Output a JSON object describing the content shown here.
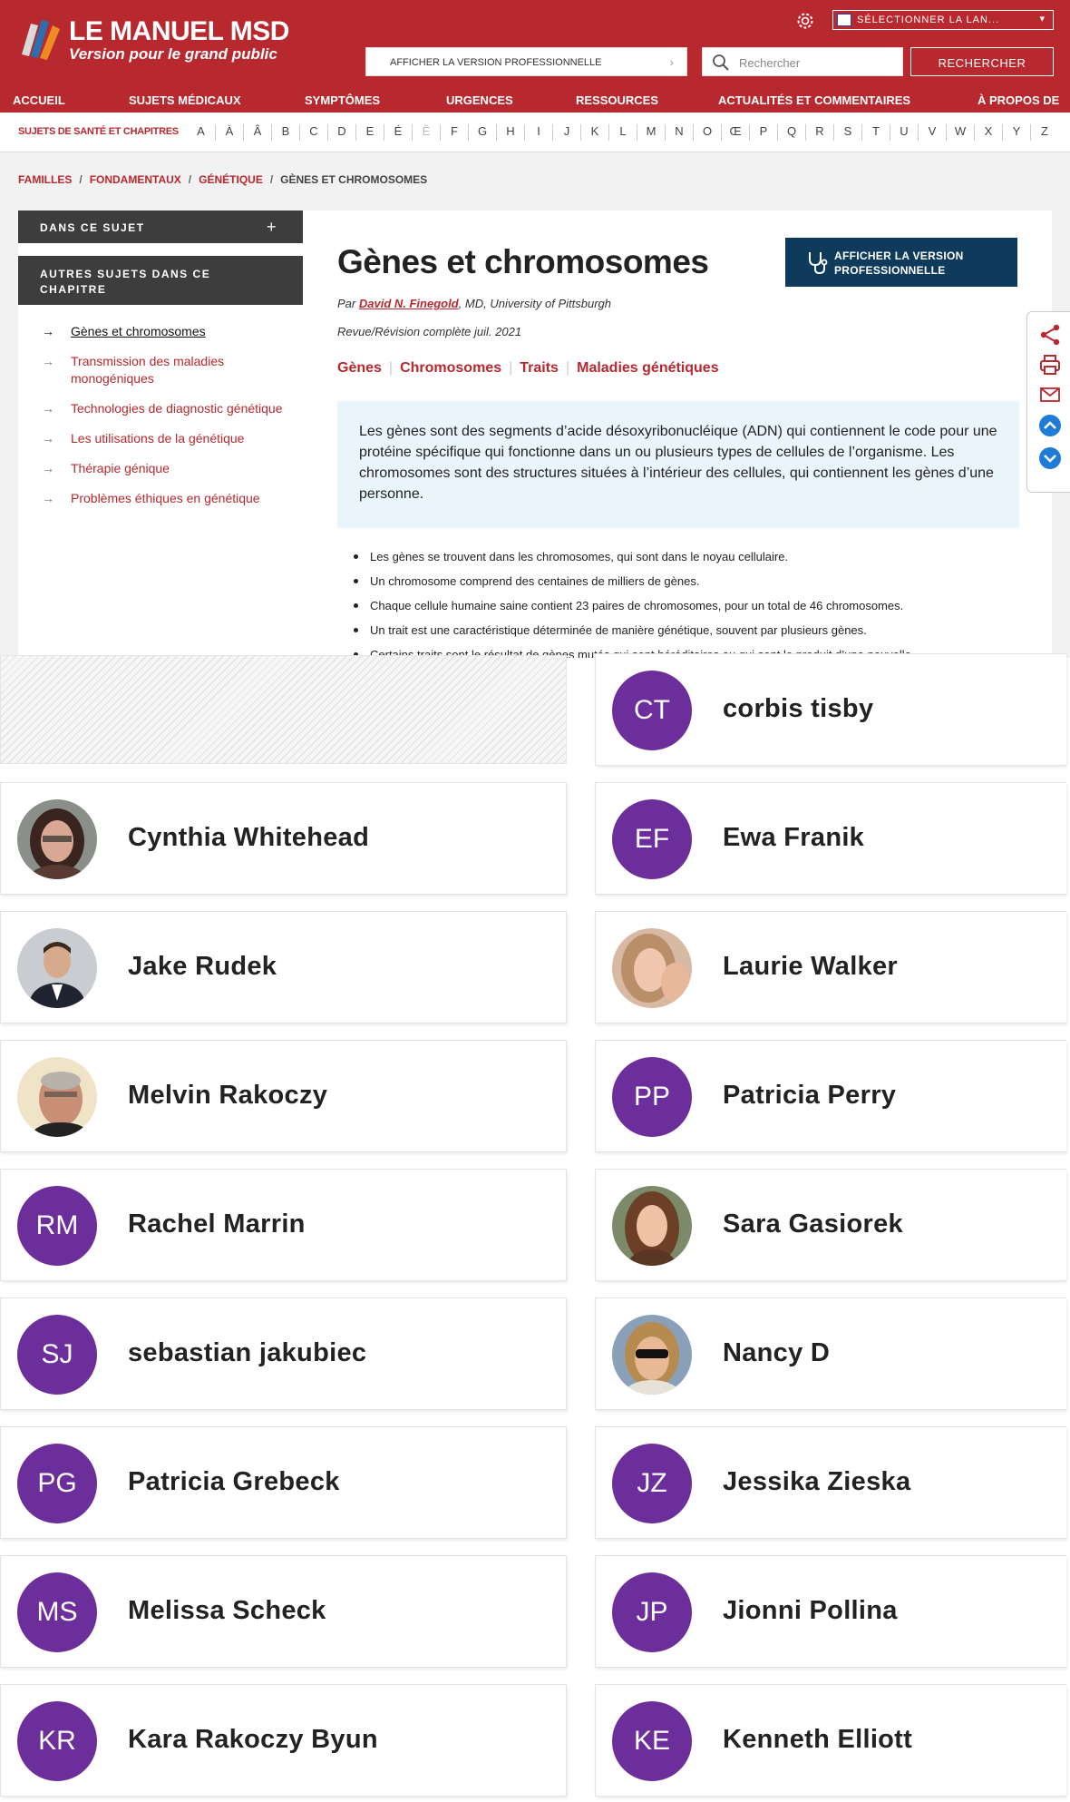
{
  "header": {
    "logo_title": "LE MANUEL MSD",
    "logo_subtitle": "Version pour le grand public",
    "language_select": "SÉLECTIONNER LA LAN...",
    "pro_version_link": "AFFICHER LA VERSION PROFESSIONNELLE",
    "search_placeholder": "Rechercher",
    "search_button": "RECHERCHER",
    "nav": [
      "ACCUEIL",
      "SUJETS MÉDICAUX",
      "SYMPTÔMES",
      "URGENCES",
      "RESSOURCES",
      "ACTUALITÉS ET COMMENTAIRES",
      "À PROPOS DE"
    ]
  },
  "alphabet": {
    "label": "SUJETS DE SANTÉ ET CHAPITRES",
    "letters": [
      "A",
      "À",
      "Â",
      "B",
      "C",
      "D",
      "E",
      "É",
      "Ê",
      "F",
      "G",
      "H",
      "I",
      "J",
      "K",
      "L",
      "M",
      "N",
      "O",
      "Œ",
      "P",
      "Q",
      "R",
      "S",
      "T",
      "U",
      "V",
      "W",
      "X",
      "Y",
      "Z"
    ]
  },
  "breadcrumb": [
    "FAMILLES",
    "FONDAMENTAUX",
    "GÉNÉTIQUE",
    "GÈNES ET CHROMOSOMES"
  ],
  "sidebar": {
    "in_topic": "DANS CE SUJET",
    "other_topics": "AUTRES SUJETS DANS CE CHAPITRE",
    "items": [
      "Gènes et chromosomes",
      "Transmission des maladies monogéniques",
      "Technologies de diagnostic génétique",
      "Les utilisations de la génétique",
      "Thérapie génique",
      "Problèmes éthiques en génétique"
    ]
  },
  "article": {
    "title": "Gènes et chromosomes",
    "pro_button": "AFFICHER LA VERSION PROFESSIONNELLE",
    "by": "Par",
    "author": "David N. Finegold",
    "author_suffix": ", MD, University of Pittsburgh",
    "review": "Revue/Révision complète juil. 2021",
    "tags": [
      "Gènes",
      "Chromosomes",
      "Traits",
      "Maladies génétiques"
    ],
    "summary": "Les gènes sont des segments d’acide désoxyribonucléique (ADN) qui contiennent le code pour une protéine spécifique qui fonctionne dans un ou plusieurs types de cellules de l’organisme. Les chromosomes sont des structures situées à l’intérieur des cellules, qui contiennent les gènes d’une personne.",
    "bullets": [
      "Les gènes se trouvent dans les chromosomes, qui sont dans le noyau cellulaire.",
      "Un chromosome comprend des centaines de milliers de gènes.",
      "Chaque cellule humaine saine contient 23 paires de chromosomes, pour un total de 46 chromosomes.",
      "Un trait est une caractéristique déterminée de manière génétique, souvent par plusieurs gènes.",
      "Certains traits sont le résultat de gènes mutés qui sont héréditaires ou qui sont le produit d’une nouvelle"
    ]
  },
  "share_icons": [
    "share-icon",
    "print-icon",
    "email-icon",
    "scroll-up-icon",
    "scroll-down-icon"
  ],
  "people": {
    "avatar_color": "#6c2e9b",
    "left": [
      {
        "name": "Cynthia Whitehead",
        "photo": true
      },
      {
        "name": "Jake Rudek",
        "photo": true
      },
      {
        "name": "Melvin Rakoczy",
        "photo": true
      },
      {
        "name": "Rachel Marrin",
        "initials": "RM"
      },
      {
        "name": "sebastian jakubiec",
        "initials": "SJ"
      },
      {
        "name": "Patricia Grebeck",
        "initials": "PG"
      },
      {
        "name": "Melissa Scheck",
        "initials": "MS"
      },
      {
        "name": "Kara Rakoczy Byun",
        "initials": "KR"
      }
    ],
    "right": [
      {
        "name": "corbis tisby",
        "initials": "CT"
      },
      {
        "name": "Ewa Franik",
        "initials": "EF"
      },
      {
        "name": "Laurie Walker",
        "photo": true
      },
      {
        "name": "Patricia Perry",
        "initials": "PP"
      },
      {
        "name": "Sara Gasiorek",
        "photo": true
      },
      {
        "name": "Nancy D",
        "photo": true
      },
      {
        "name": "Jessika Zieska",
        "initials": "JZ"
      },
      {
        "name": "Jionni Pollina",
        "initials": "JP"
      },
      {
        "name": "Kenneth Elliott",
        "initials": "KE"
      }
    ]
  }
}
